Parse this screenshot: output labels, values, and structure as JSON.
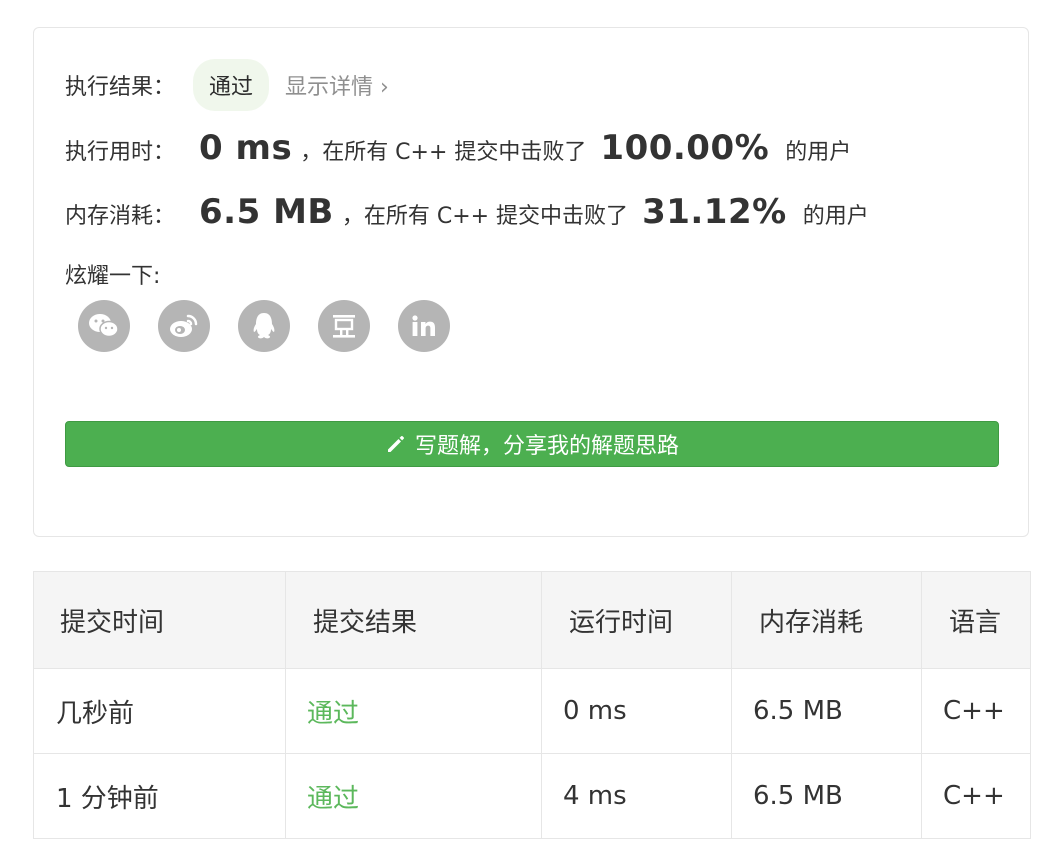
{
  "result": {
    "label": "执行结果：",
    "status": "通过",
    "details_link": "显示详情 ›"
  },
  "runtime": {
    "label": "执行用时：",
    "value": "0 ms",
    "middle": "，在所有 C++ 提交中击败了",
    "percent": "100.00%",
    "suffix": "的用户"
  },
  "memory": {
    "label": "内存消耗：",
    "value": "6.5 MB",
    "middle": "，在所有 C++ 提交中击败了",
    "percent": "31.12%",
    "suffix": "的用户"
  },
  "share": {
    "label": "炫耀一下:",
    "icons": [
      "wechat-icon",
      "weibo-icon",
      "qq-icon",
      "douban-icon",
      "linkedin-icon"
    ]
  },
  "write_solution_button": "写题解，分享我的解题思路",
  "colors": {
    "button": "#4caf50",
    "pass_text": "#5cb85c",
    "badge_bg": "#f0f7ec",
    "icon_bg": "#b5b5b5"
  },
  "submissions": {
    "headers": [
      "提交时间",
      "提交结果",
      "运行时间",
      "内存消耗",
      "语言"
    ],
    "rows": [
      [
        "几秒前",
        "通过",
        "0 ms",
        "6.5 MB",
        "C++"
      ],
      [
        "1 分钟前",
        "通过",
        "4 ms",
        "6.5 MB",
        "C++"
      ]
    ]
  }
}
